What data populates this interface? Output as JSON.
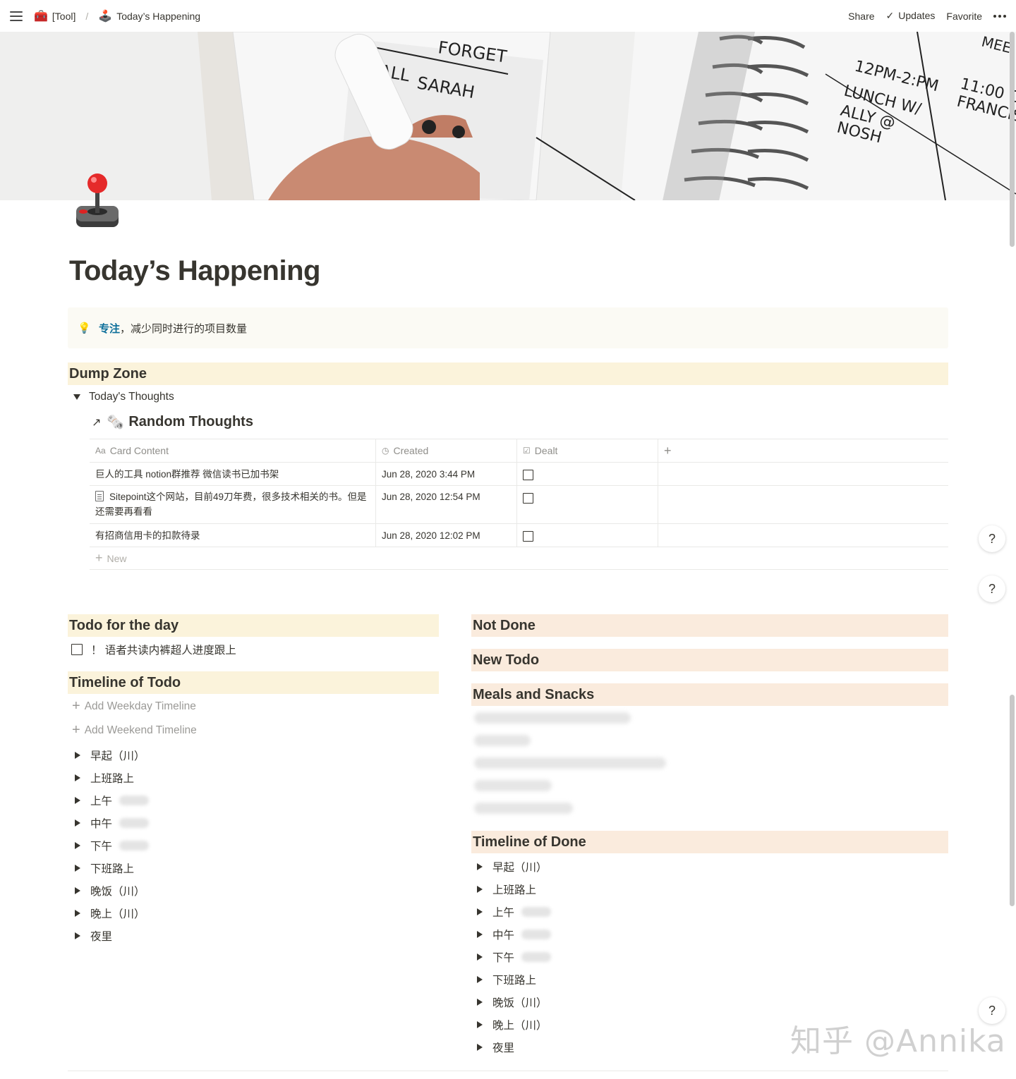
{
  "topbar": {
    "parent_emoji": "🧰",
    "parent_label": "[Tool]",
    "separator": "/",
    "page_emoji": "🕹️",
    "page_label": "Today’s Happening",
    "share": "Share",
    "updates": "Updates",
    "favorite": "Favorite"
  },
  "page": {
    "title": "Today’s Happening"
  },
  "callout": {
    "emoji": "💡",
    "strong": "专注",
    "text": "，减少同时进行的项目数量"
  },
  "dump_zone": {
    "heading": "Dump Zone",
    "toggle": "Today's Thoughts",
    "linked_db_emoji": "🗞️",
    "linked_db_title": "Random Thoughts",
    "columns": [
      "Card Content",
      "Created",
      "Dealt"
    ],
    "rows": [
      {
        "content": "巨人的工具 notion群推荐 微信读书已加书架",
        "created": "Jun 28, 2020 3:44 PM",
        "has_doc": false
      },
      {
        "content": "Sitepoint这个网站，目前49刀年费，很多技术相关的书。但是还需要再看看",
        "created": "Jun 28, 2020 12:54 PM",
        "has_doc": true
      },
      {
        "content": "有招商信用卡的扣款待录",
        "created": "Jun 28, 2020 12:02 PM",
        "has_doc": false
      }
    ],
    "new_label": "New"
  },
  "todo": {
    "heading": "Todo for the day",
    "item": "！ 语者共读内裤超人进度跟上"
  },
  "timeline_todo": {
    "heading": "Timeline of Todo",
    "add_weekday": "Add Weekday Timeline",
    "add_weekend": "Add Weekend Timeline",
    "items": [
      "早起（川）",
      "上班路上",
      "上午",
      "中午",
      "下午",
      "下班路上",
      "晚饭（川）",
      "晚上（川）",
      "夜里"
    ]
  },
  "right_column": {
    "not_done": "Not Done",
    "new_todo": "New Todo",
    "meals": "Meals and Snacks",
    "timeline_done": "Timeline of Done",
    "done_items": [
      "早起（川）",
      "上班路上",
      "上午",
      "中午",
      "下午",
      "下班路上",
      "晚饭（川）",
      "晚上（川）",
      "夜里"
    ]
  },
  "help_label": "?",
  "watermark": "知乎 @Annika"
}
